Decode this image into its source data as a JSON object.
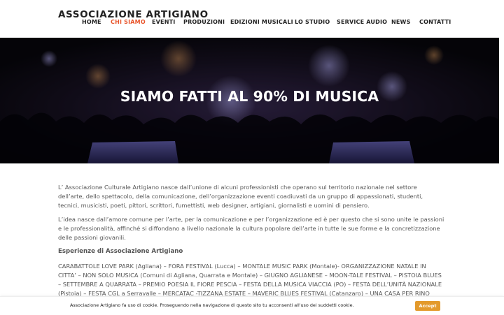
{
  "site": {
    "brand": "ASSOCIAZIONE ARTIGIANO"
  },
  "nav": {
    "items": [
      {
        "label": "HOME"
      },
      {
        "label": "CHI SIAMO"
      },
      {
        "label": "EVENTI"
      },
      {
        "label": "PRODUZIONI"
      },
      {
        "label": "EDIZIONI MUSICALI"
      },
      {
        "label": "LO STUDIO"
      },
      {
        "label": "SERVICE AUDIO"
      },
      {
        "label": "NEWS"
      },
      {
        "label": "CONTATTI"
      }
    ],
    "active_color": "#e8542a"
  },
  "hero": {
    "title": "SIAMO FATTI AL 90% DI MUSICA"
  },
  "content": {
    "paragraph1": "L’ Associazione Culturale Artigiano nasce dall’unione di alcuni professionisti che operano sul territorio nazionale nel settore dell’arte, dello spettacolo, della comunicazione, dell’organizzazione eventi coadiuvati da un gruppo di appassionati, studenti, tecnici, musicisti, poeti, pittori, scrittori, fumettisti, web designer, artigiani, giornalisti e uomini di pensiero.",
    "paragraph2": "L’idea nasce dall’amore comune per l’arte, per la comunicazione e per l’organizzazione ed è per questo che si sono unite le passioni e le professionalità, affinché si diffondano a livello nazionale la cultura popolare dell’arte in tutte le sue forme e la concretizzazione delle passioni giovanili.",
    "heading": "Esperienze di Associazione Artigiano",
    "paragraph3": "CARABATTOLE LOVE PARK (Agliana) – FORA FESTIVAL (Lucca) – MONTALE MUSIC PARK (Montale)- ORGANIZZAZIONE NATALE IN CITTA’ – NON SOLO MUSICA (Comuni di Agliana, Quarrata e Montale) – GIUGNO AGLIANESE – MOON-TALE FESTIVAL – PISTOIA BLUES – SETTEMBRE A QUARRATA – PREMIO POESIA IL FIORE PESCIA – FESTA DELLA MUSICA VIACCIA (PO) – FESTA DELL’UNITÀ NAZIONALE (Pistoia) – FESTA CGL a Serravalle – MERCATAC -TIZZANA ESTATE – MAVERIC BLUES FESTIVAL (Catanzaro) – UNA CASA PER RINO (Crotone) – GIFFONI MUSIC CONCEPT (Salerno)- ASTI"
  },
  "cookie": {
    "text": "Associazione Artigiano fa uso di cookie. Proseguendo nella navigazione di questo sito tu acconsenti all'uso dei suddetti cookie.",
    "accept_label": "Accept",
    "button_color": "#e39a2c"
  }
}
